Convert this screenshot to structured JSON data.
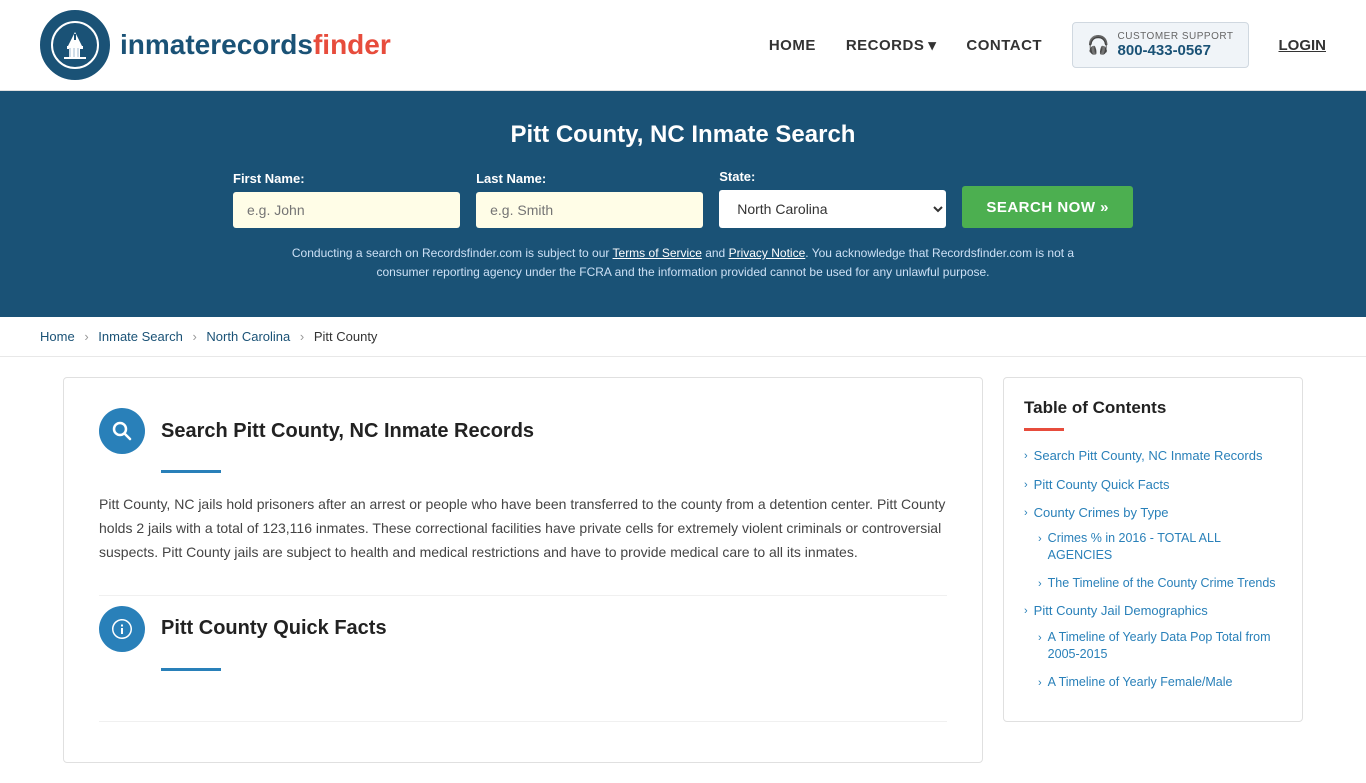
{
  "header": {
    "logo_text_light": "inmaterecords",
    "logo_text_bold": "finder",
    "nav": {
      "home": "HOME",
      "records": "RECORDS",
      "contact": "CONTACT",
      "login": "LOGIN"
    },
    "support": {
      "label": "CUSTOMER SUPPORT",
      "number": "800-433-0567"
    }
  },
  "hero": {
    "title": "Pitt County, NC Inmate Search",
    "form": {
      "first_name_label": "First Name:",
      "first_name_placeholder": "e.g. John",
      "last_name_label": "Last Name:",
      "last_name_placeholder": "e.g. Smith",
      "state_label": "State:",
      "state_value": "North Carolina",
      "search_button": "SEARCH NOW »"
    },
    "disclaimer": "Conducting a search on Recordsfinder.com is subject to our Terms of Service and Privacy Notice. You acknowledge that Recordsfinder.com is not a consumer reporting agency under the FCRA and the information provided cannot be used for any unlawful purpose."
  },
  "breadcrumb": {
    "home": "Home",
    "inmate_search": "Inmate Search",
    "north_carolina": "North Carolina",
    "pitt_county": "Pitt County"
  },
  "main_content": {
    "section1": {
      "title": "Search Pitt County, NC Inmate Records",
      "body": "Pitt County, NC jails hold prisoners after an arrest or people who have been transferred to the county from a detention center. Pitt County holds 2 jails with a total of 123,116 inmates. These correctional facilities have private cells for extremely violent criminals or controversial suspects. Pitt County jails are subject to health and medical restrictions and have to provide medical care to all its inmates."
    },
    "section2": {
      "title": "Pitt County Quick Facts"
    }
  },
  "sidebar": {
    "toc_title": "Table of Contents",
    "items": [
      {
        "label": "Search Pitt County, NC Inmate Records",
        "sub": []
      },
      {
        "label": "Pitt County Quick Facts",
        "sub": []
      },
      {
        "label": "County Crimes by Type",
        "sub": [
          {
            "label": "Crimes % in 2016 - TOTAL ALL AGENCIES"
          },
          {
            "label": "The Timeline of the County Crime Trends"
          }
        ]
      },
      {
        "label": "Pitt County Jail Demographics",
        "sub": [
          {
            "label": "A Timeline of Yearly Data Pop Total from 2005-2015"
          },
          {
            "label": "A Timeline of Yearly Female/Male"
          }
        ]
      }
    ]
  }
}
